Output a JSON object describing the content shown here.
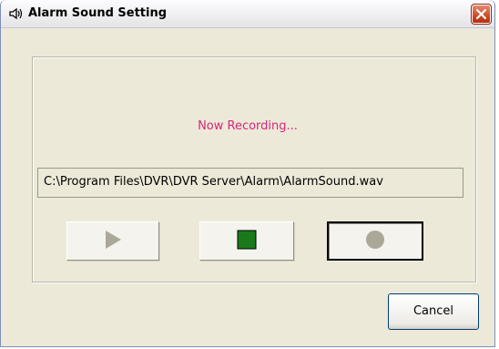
{
  "window": {
    "title": "Alarm Sound Setting",
    "title_icon": "speaker-icon",
    "close_icon": "close-icon"
  },
  "main": {
    "status_text": "Now Recording...",
    "status_color": "#d6277a",
    "file_path": "C:\\Program Files\\DVR\\DVR Server\\Alarm\\AlarmSound.wav",
    "controls": [
      {
        "name": "play",
        "icon": "play-icon",
        "enabled": false
      },
      {
        "name": "stop",
        "icon": "stop-icon",
        "enabled": true,
        "color": "#1a7a1a"
      },
      {
        "name": "record",
        "icon": "record-icon",
        "enabled": false
      }
    ]
  },
  "footer": {
    "cancel_label": "Cancel"
  }
}
